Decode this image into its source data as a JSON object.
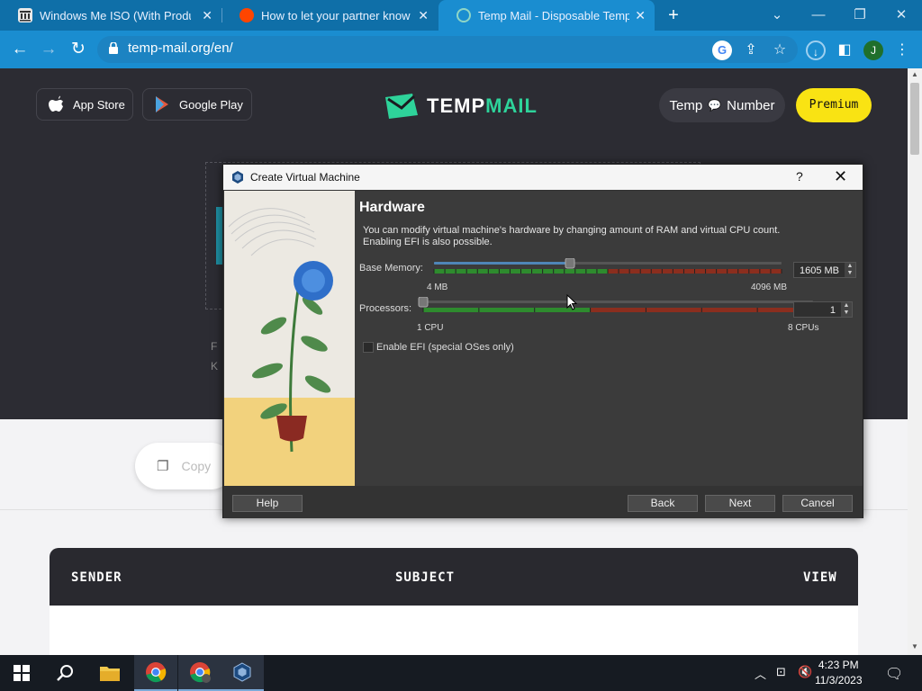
{
  "browser": {
    "tabs": [
      {
        "title": "Windows Me ISO (With Product",
        "icon": "archive-icon",
        "active": false
      },
      {
        "title": "How to let your partner know yo",
        "icon": "reddit-icon",
        "active": false
      },
      {
        "title": "Temp Mail - Disposable Tempora",
        "icon": "tempmail-icon",
        "active": true
      }
    ],
    "url": "temp-mail.org/en/",
    "profile_initial": "J",
    "colors": {
      "tabbar": "#0f6fa8",
      "toolbar": "#1a8dd0"
    }
  },
  "page": {
    "app_store_label": "App Store",
    "google_play_label": "Google Play",
    "logo_temp": "TEMP",
    "logo_mail": "MAIL",
    "temp_label": "Temp",
    "number_label": "Number",
    "premium_label": "Premium",
    "copy_label": "Copy",
    "bg_text_1": "F",
    "bg_text_2": "K",
    "inbox_columns": {
      "sender": "SENDER",
      "subject": "SUBJECT",
      "view": "VIEW"
    },
    "colors": {
      "brand": "#2ed39a",
      "premium": "#f9e313"
    }
  },
  "dialog": {
    "title": "Create Virtual Machine",
    "help_glyph": "?",
    "close_glyph": "✕",
    "heading": "Hardware",
    "description": "You can modify virtual machine's hardware by changing amount of RAM and virtual CPU count. Enabling EFI is also possible.",
    "memory": {
      "label": "Base Memory:",
      "value": "1605 MB",
      "value_mb": 1605,
      "min_label": "4 MB",
      "max_label": "4096 MB",
      "min_mb": 4,
      "max_mb": 4096
    },
    "processors": {
      "label": "Processors:",
      "value": "1",
      "value_cpu": 1,
      "min_label": "1 CPU",
      "max_label": "8 CPUs",
      "min_cpu": 1,
      "max_cpu": 8
    },
    "efi": {
      "label": "Enable EFI (special OSes only)",
      "checked": false
    },
    "buttons": {
      "help": "Help",
      "back": "Back",
      "next": "Next",
      "cancel": "Cancel"
    },
    "colors": {
      "green_zone": "#2e8b2e",
      "red_zone": "#8b2e1e"
    }
  },
  "taskbar": {
    "time": "4:23 PM",
    "date": "11/3/2023",
    "apps": [
      "start-icon",
      "search-icon",
      "file-explorer-icon",
      "chrome-icon",
      "chrome-profile-icon",
      "virtualbox-icon"
    ]
  }
}
